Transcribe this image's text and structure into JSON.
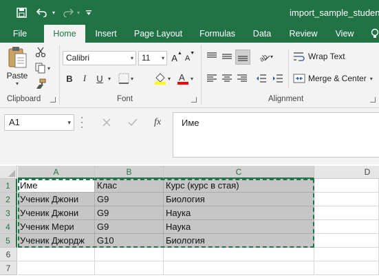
{
  "window": {
    "title": "import_sample_studentc"
  },
  "qat": {
    "save_icon": "save-icon",
    "undo_icon": "undo-icon",
    "redo_icon": "redo-icon",
    "customize_icon": "customize-qat-icon"
  },
  "tabs": [
    "File",
    "Home",
    "Insert",
    "Page Layout",
    "Formulas",
    "Data",
    "Review",
    "View"
  ],
  "active_tab": "Home",
  "ribbon": {
    "clipboard": {
      "label": "Clipboard",
      "paste": "Paste"
    },
    "font": {
      "label": "Font",
      "font_name": "Calibri",
      "font_size": "11",
      "bold": "B",
      "italic": "I",
      "underline": "U",
      "grow": "A",
      "shrink": "A",
      "fill_color": "#ffff00",
      "font_color": "#ff0000"
    },
    "alignment": {
      "label": "Alignment",
      "wrap_text": "Wrap Text",
      "merge_center": "Merge & Center"
    }
  },
  "formula_bar": {
    "name_box": "A1",
    "fx": "fx",
    "content": "Име"
  },
  "sheet": {
    "columns": [
      "A",
      "B",
      "C",
      "D"
    ],
    "rows": [
      "1",
      "2",
      "3",
      "4",
      "5",
      "6",
      "7"
    ],
    "cells": [
      [
        "Име",
        "Клас",
        "Курс (курс в стая)"
      ],
      [
        "Ученик Джони",
        "G9",
        "Биология"
      ],
      [
        "Ученик Джони",
        "G9",
        "Наука"
      ],
      [
        "Ученик Мери",
        "G9",
        "Наука"
      ],
      [
        "Ученик Джордж",
        "G10",
        "Биология"
      ]
    ]
  },
  "colors": {
    "accent": "#217346",
    "selection": "#c6c6c6"
  }
}
